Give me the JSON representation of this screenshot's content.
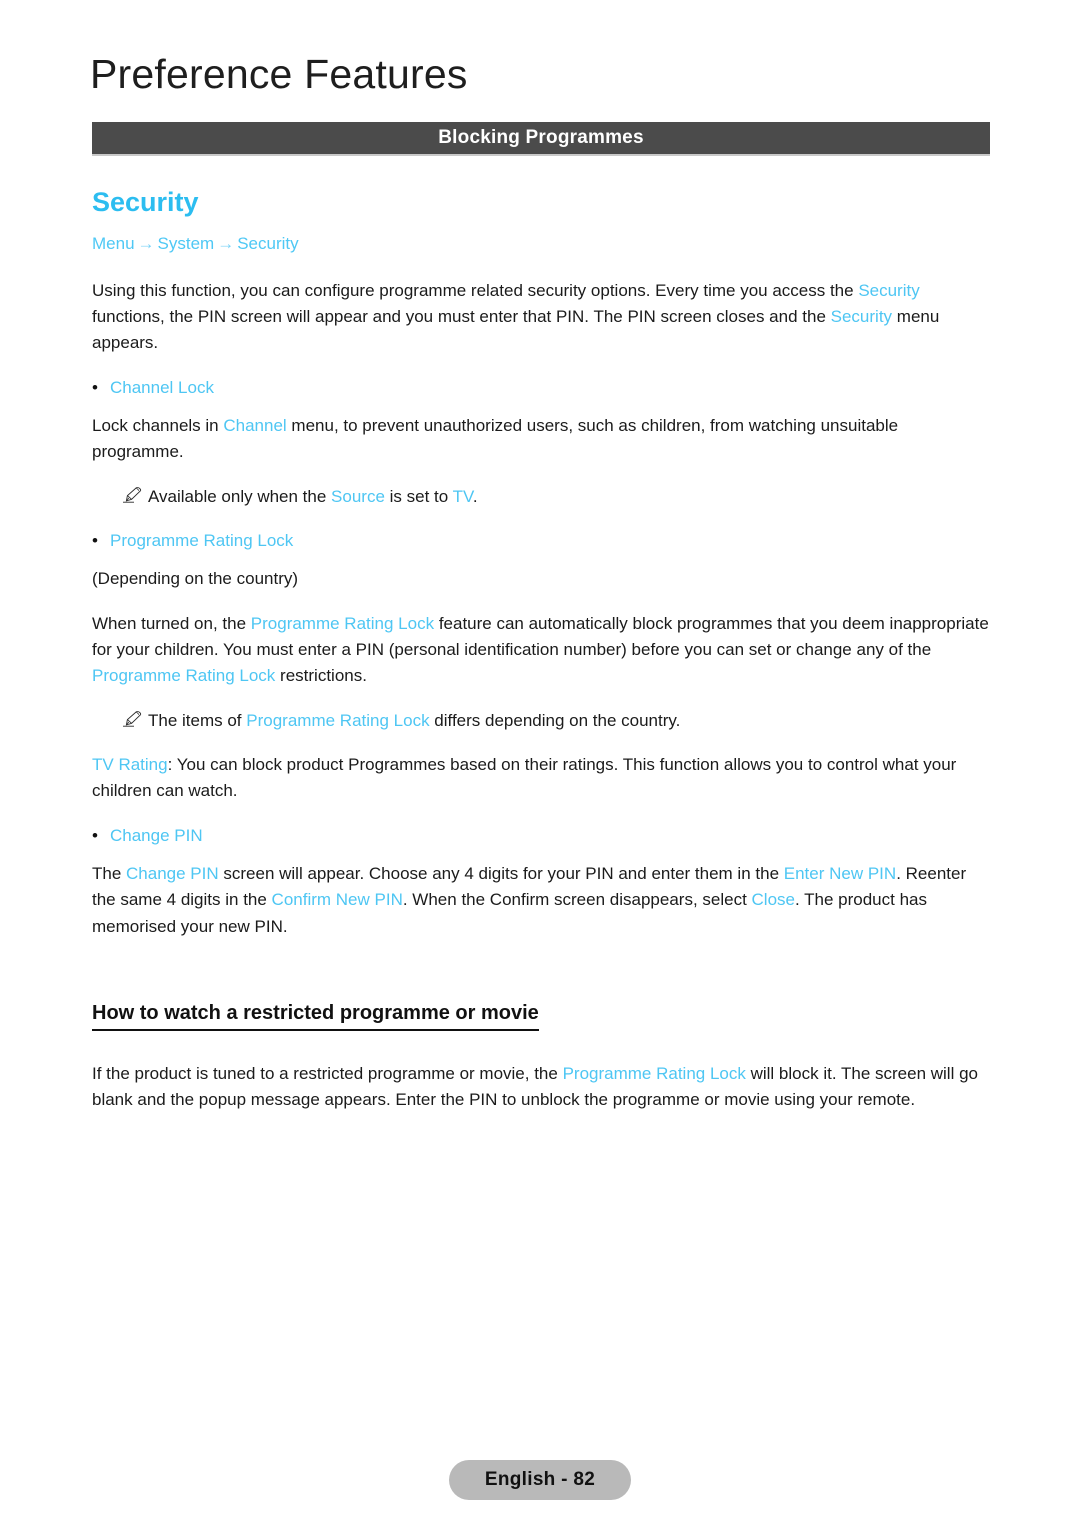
{
  "page": {
    "chapter_title": "Preference Features",
    "section_bar_label": "Blocking Programmes",
    "footer_label": "English - 82"
  },
  "colors": {
    "accent_blue": "#4ec6f3",
    "heading_blue": "#2cbdf0",
    "section_bar_bg": "#4b4b4b",
    "footer_pill_bg": "#b9b9b9",
    "body_text": "#1b1b1b"
  },
  "security": {
    "heading": "Security",
    "breadcrumb": {
      "items": [
        "Menu",
        "System",
        "Security"
      ],
      "separator": "→"
    },
    "intro": {
      "part1": "Using this function, you can configure programme related security options. Every time you access the ",
      "link1": "Security",
      "part2": " functions, the PIN screen will appear and you must enter that PIN. The PIN screen closes and the ",
      "link2": "Security",
      "part3": " menu appears."
    }
  },
  "channel_lock": {
    "bullet": "•",
    "label": "Channel Lock",
    "body": {
      "part1": "Lock channels in ",
      "link1": "Channel",
      "part2": " menu, to prevent unauthorized users, such as children, from watching unsuitable programme."
    },
    "note": {
      "icon": "pencil-note-icon",
      "part1": "Available only when the ",
      "link1": "Source",
      "part2": " is set to ",
      "link2": "TV",
      "part3": "."
    }
  },
  "programme_rating_lock": {
    "bullet": "•",
    "label": "Programme Rating Lock",
    "country_note": "(Depending on the country)",
    "body": {
      "part1": "When turned on, the ",
      "link1": "Programme Rating Lock",
      "part2": " feature can automatically block programmes that you deem inappropriate for your children. You must enter a PIN (personal identification number) before you can set or change any of the ",
      "link2": "Programme Rating Lock",
      "part3": " restrictions."
    },
    "note": {
      "icon": "pencil-note-icon",
      "part1": "The items of ",
      "link1": "Programme Rating Lock",
      "part2": " differs depending on the country."
    },
    "tv_rating": {
      "link1": "TV Rating",
      "part1": ": You can block product Programmes based on their ratings. This function allows you to control what your children can watch."
    }
  },
  "change_pin": {
    "bullet": "•",
    "label": "Change PIN",
    "body": {
      "part1": "The ",
      "link1": "Change PIN",
      "part2": " screen will appear. Choose any 4 digits for your PIN and enter them in the ",
      "link2": "Enter New PIN",
      "part3": ". Reenter the same 4 digits in the ",
      "link3": "Confirm New PIN",
      "part4": ". When the Confirm screen disappears, select ",
      "link4": "Close",
      "part5": ". The product has memorised your new PIN."
    }
  },
  "restricted": {
    "heading": "How to watch a restricted programme or movie",
    "body": {
      "part1": "If the product is tuned to a restricted programme or movie, the ",
      "link1": "Programme Rating Lock",
      "part2": " will block it. The screen will go blank and the popup message appears. Enter the PIN to unblock the programme or movie using your remote."
    }
  }
}
